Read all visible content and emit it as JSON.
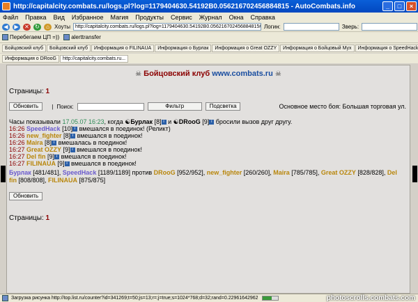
{
  "window": {
    "title": "http://capitalcity.combats.ru/logs.pl?log=1179404630.54192B0.056216702456884815 - AutoCombats.info"
  },
  "menu": [
    "Файл",
    "Правка",
    "Вид",
    "Избранное",
    "Магия",
    "Продукты",
    "Сервис",
    "Журнал",
    "Окна",
    "Справка"
  ],
  "toolbar": {
    "favorites": "Хоуты",
    "address": "http://capitalcity.combats.ru/logs.pl?log=1179404630.54192B0.056216702456884815#end",
    "login_label": "Логин:",
    "door_label": "Зверь:"
  },
  "links": [
    "Перебегаем ЦП =))",
    "alerttransfer"
  ],
  "tabs_row1": [
    "Бойцовский клуб",
    "Бойцовский клуб",
    "Информация о FILINAUA",
    "Информация о Бурлак",
    "Информация о Great OZZY",
    "Информация о Бойцовый Мух",
    "Информация о SpeedHack"
  ],
  "tabs_row2": [
    "Информация о DRooG",
    "http://capitalcity.combats.ru..."
  ],
  "page": {
    "header_text": "Бойцовский клуб",
    "header_url": "www.combats.ru",
    "pages_label": "Страницы:",
    "pages_value": "1",
    "refresh_button": "Обновить",
    "search_label": "Поиск:",
    "filter_button": "Фильтр",
    "highlight_button": "Подсветка",
    "battle_place": "Основное место боя: Большая торговая ул.",
    "clock_line_prefix": "Часы показывали",
    "clock_date": "17.05.07 16:23",
    "clock_when": ", когда",
    "p1_name": "Бурлак",
    "p1_level": "[8]",
    "and_word": " и ",
    "p2_name": "DRooG",
    "p2_level": "[9]",
    "challenge": "бросили вызов друг другу.",
    "log_lines": [
      {
        "time": "16:26",
        "name": "SpeedHack",
        "level": "[10]",
        "text": "вмешался в поединок! (Реликт)",
        "cls": "p1"
      },
      {
        "time": "16:26",
        "name": "new_fighter",
        "level": "[8]",
        "text": "вмешался в поединок!",
        "cls": "p2"
      },
      {
        "time": "16:26",
        "name": "Maira",
        "level": "[8]",
        "text": "вмешалась в поединок!",
        "cls": "p2"
      },
      {
        "time": "16:27",
        "name": "Great OZZY",
        "level": "[9]",
        "text": "вмешался в поединок!",
        "cls": "p2"
      },
      {
        "time": "16:27",
        "name": "Del fin",
        "level": "[9]",
        "text": "вмешался в поединок!",
        "cls": "p2"
      },
      {
        "time": "16:27",
        "name": "FILINAUA",
        "level": "[9]",
        "text": "вмешался в поединок!",
        "cls": "p2"
      }
    ],
    "hp_team1": [
      {
        "name": "Бурлак",
        "hp": "[481/481]"
      },
      {
        "name": "SpeedHack",
        "hp": "[1189/1189]"
      }
    ],
    "vs_word": "против",
    "hp_team2": [
      {
        "name": "DRooG",
        "hp": "[952/952]"
      },
      {
        "name": "new_fighter",
        "hp": "[260/260]"
      },
      {
        "name": "Maira",
        "hp": "[785/785]"
      },
      {
        "name": "Great OZZY",
        "hp": "[828/828]"
      },
      {
        "name": "Del fin",
        "hp": "[808/808]"
      },
      {
        "name": "FILINAUA",
        "hp": "[875/875]"
      }
    ],
    "refresh_button2": "Обновить",
    "pages_label2": "Страницы:",
    "pages_value2": "1"
  },
  "status": {
    "text": "Загрузка рисунка http://top.list.ru/counter?id=341269;t=50;js=13;r=;j=true;s=1024*768;d=32;rand=0.22961642962",
    "progress": 0.6,
    "watermark": "photoscrolls.combats.com"
  },
  "colors": {
    "accent": "#8b0000",
    "link": "#1a4ea0",
    "team1": "#6a5acd",
    "team2": "#b8860b"
  }
}
